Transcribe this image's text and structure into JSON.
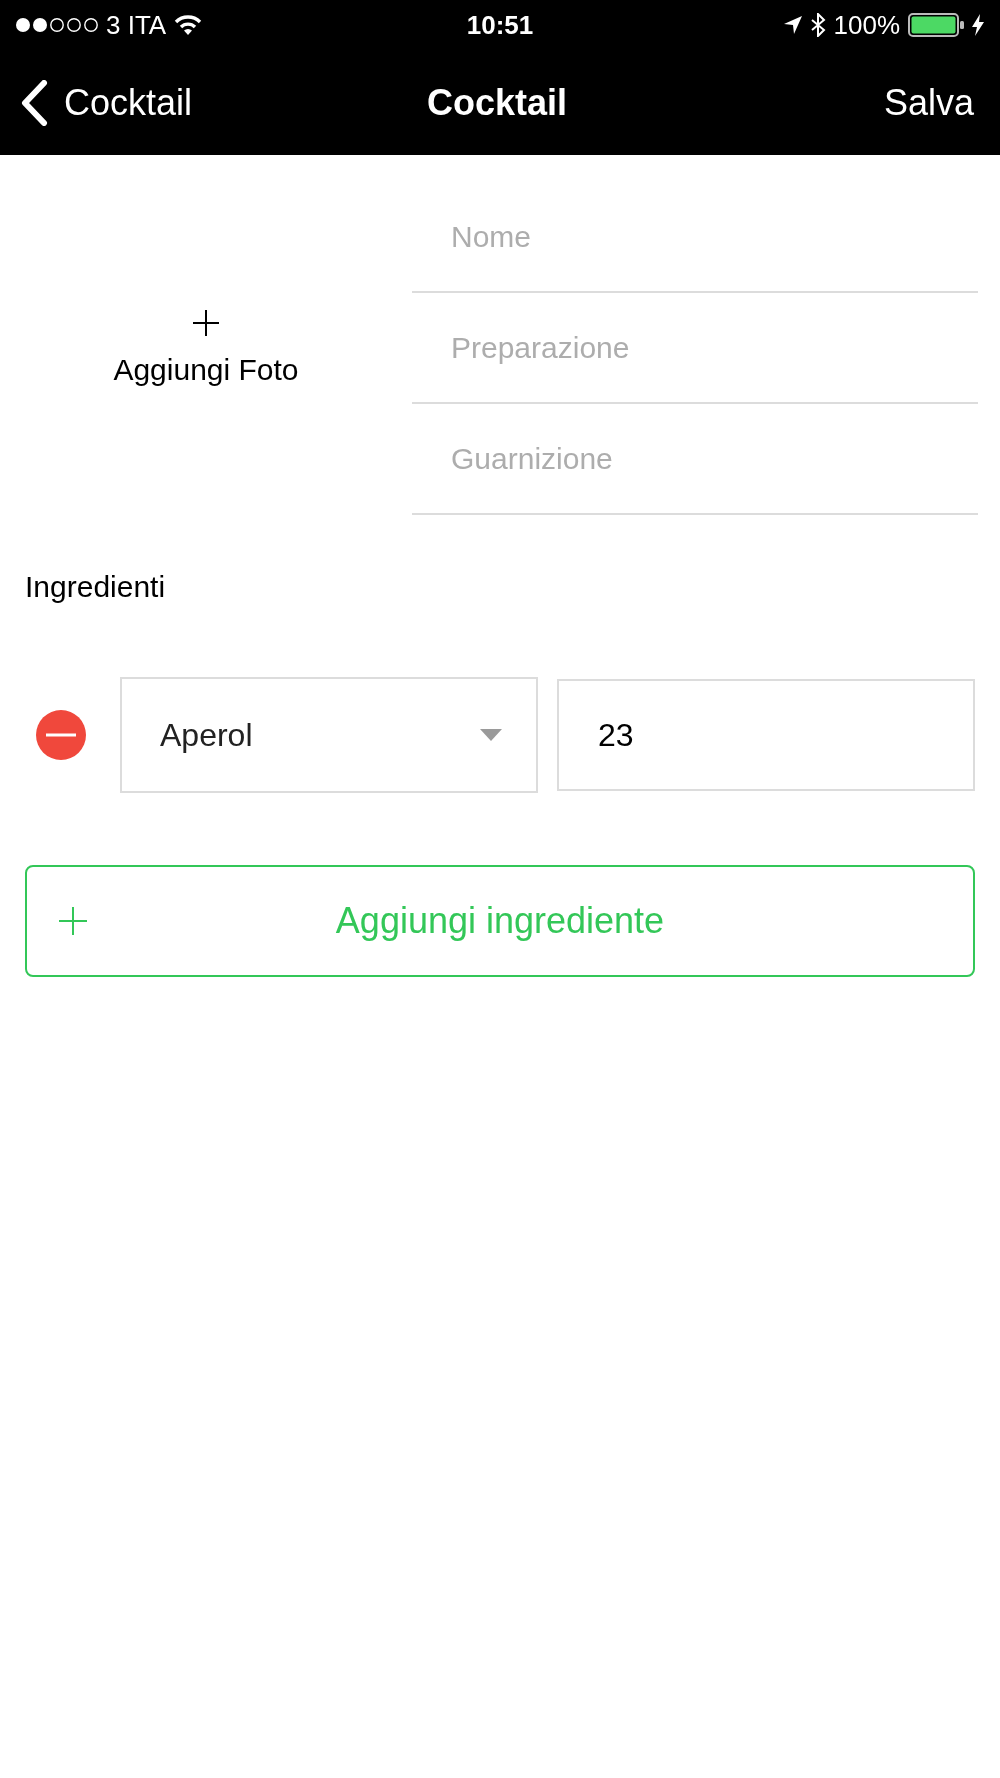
{
  "status_bar": {
    "carrier": "3 ITA",
    "time": "10:51",
    "battery": "100%"
  },
  "nav_bar": {
    "back_label": "Cocktail",
    "title": "Cocktail",
    "action": "Salva"
  },
  "photo": {
    "label": "Aggiungi Foto"
  },
  "fields": [
    {
      "placeholder": "Nome"
    },
    {
      "placeholder": "Preparazione"
    },
    {
      "placeholder": "Guarnizione"
    }
  ],
  "ingredients": {
    "title": "Ingredienti",
    "rows": [
      {
        "name": "Aperol",
        "amount": "23"
      }
    ],
    "add_label": "Aggiungi ingrediente"
  }
}
